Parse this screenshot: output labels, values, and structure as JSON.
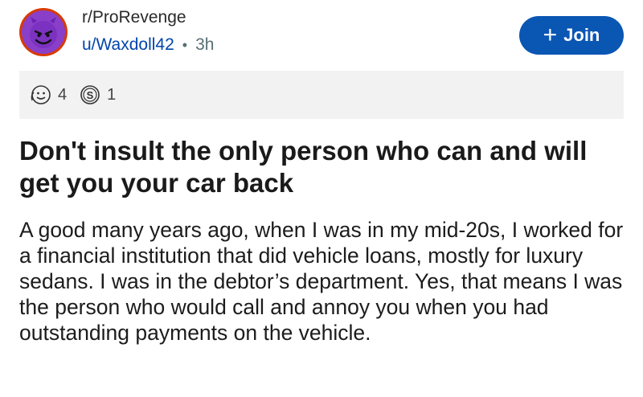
{
  "post": {
    "subreddit": "r/ProRevenge",
    "username": "u/Waxdoll42",
    "separator": "•",
    "time": "3h",
    "join_label": "Join",
    "join_plus": "+",
    "avatar_icon": "devil-smiley-icon",
    "awards": [
      {
        "icon": "wholesome-award-icon",
        "count": "4"
      },
      {
        "icon": "silver-award-icon",
        "count": "1"
      }
    ],
    "title": "Don't insult the only person who can and will get you your car back",
    "body": "A good many years ago, when I was in my mid-20s, I worked for a financial institution that did vehicle loans, mostly for luxury sedans. I was in the debtor’s department. Yes, that means I was the person who would call and annoy you when you had outstanding payments on the vehicle."
  },
  "colors": {
    "brand_blue": "#0a56b3",
    "username_blue": "#0045ac",
    "avatar_ring": "#d93a00",
    "avatar_fill": "#8a3fc9",
    "awards_bg": "#f2f2f2"
  }
}
